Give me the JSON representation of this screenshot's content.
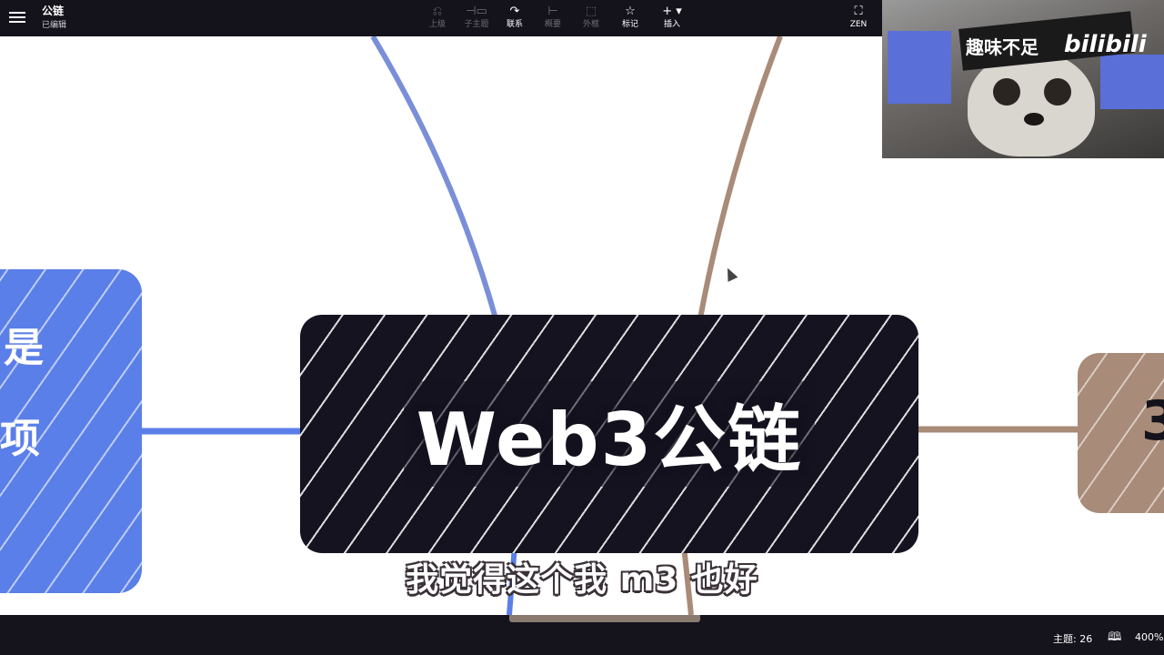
{
  "header": {
    "doc_title": "公链",
    "doc_status": "已编辑",
    "tools": [
      {
        "label": "上级",
        "icon": "parent-topic-icon",
        "enabled": false
      },
      {
        "label": "子主题",
        "icon": "subtopic-icon",
        "enabled": false
      },
      {
        "label": "联系",
        "icon": "relationship-icon",
        "enabled": true
      },
      {
        "label": "概要",
        "icon": "summary-icon",
        "enabled": false
      },
      {
        "label": "外框",
        "icon": "boundary-icon",
        "enabled": false
      },
      {
        "label": "标记",
        "icon": "star-icon",
        "enabled": true
      },
      {
        "label": "插入",
        "icon": "plus-icon",
        "enabled": true
      }
    ],
    "zen_label": "ZEN"
  },
  "canvas": {
    "central_topic": "Web3公链",
    "left_topic_line1": "是",
    "left_topic_line2": "项",
    "right_topic": "3",
    "branch_colors": {
      "blue": "#5b7fe8",
      "brown": "#a88b78",
      "central": "#15131f"
    }
  },
  "subtitle": "我觉得这个我 m3 也好",
  "webcam": {
    "caption": "趣味不足",
    "logo": "bilibili"
  },
  "footer": {
    "topics_count": "主题: 26",
    "zoom": "400%"
  }
}
